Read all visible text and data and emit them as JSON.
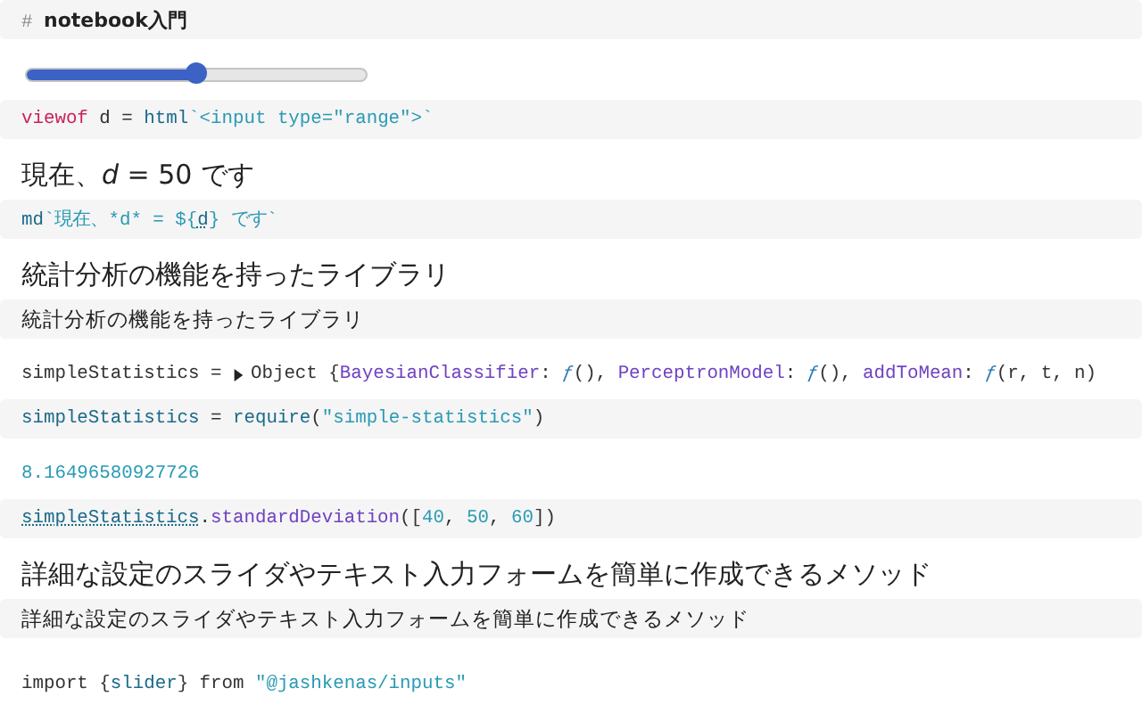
{
  "cells": [
    {
      "source": [
        {
          "kind": "comment",
          "text": "# "
        },
        {
          "kind": "bold",
          "text": "notebook入門"
        }
      ]
    },
    {
      "output": {
        "kind": "slider",
        "level": 0.5
      },
      "source": [
        {
          "kind": "keyword",
          "text": "viewof"
        },
        {
          "kind": "plain",
          "text": " d = "
        },
        {
          "kind": "variable",
          "text": "html"
        },
        {
          "kind": "string",
          "text": "`<input type=\"range\">`"
        }
      ]
    },
    {
      "output": {
        "kind": "text",
        "text": "現在、*d* = 50 です"
      },
      "source": [
        {
          "kind": "variable",
          "text": "md"
        },
        {
          "kind": "string",
          "text": "`現在、*d* = ${"
        },
        {
          "kind": "ref",
          "text": "d"
        },
        {
          "kind": "string",
          "text": "} です`"
        }
      ]
    },
    {
      "output": {
        "kind": "heading",
        "text": "統計分析の機能を持ったライブラリ"
      },
      "source": [
        {
          "kind": "prose",
          "text": "統計分析の機能を持ったライブラリ"
        }
      ]
    },
    {
      "output": {
        "kind": "object",
        "name": "simpleStatistics = ",
        "expanded": false,
        "tokens": [
          {
            "kind": "plain",
            "text": "Object {"
          },
          {
            "kind": "property",
            "text": "BayesianClassifier"
          },
          {
            "kind": "plain",
            "text": ": "
          },
          {
            "kind": "fn",
            "text": "ƒ"
          },
          {
            "kind": "plain",
            "text": "(), "
          },
          {
            "kind": "property",
            "text": "PerceptronModel"
          },
          {
            "kind": "plain",
            "text": ": "
          },
          {
            "kind": "fn",
            "text": "ƒ"
          },
          {
            "kind": "plain",
            "text": "(), "
          },
          {
            "kind": "property",
            "text": "addToMean"
          },
          {
            "kind": "plain",
            "text": ": "
          },
          {
            "kind": "fn",
            "text": "ƒ"
          },
          {
            "kind": "plain",
            "text": "(r, t, n)"
          }
        ]
      },
      "source": [
        {
          "kind": "variable",
          "text": "simpleStatistics"
        },
        {
          "kind": "plain",
          "text": " = "
        },
        {
          "kind": "variable",
          "text": "require"
        },
        {
          "kind": "plain",
          "text": "("
        },
        {
          "kind": "string",
          "text": "\"simple-statistics\""
        },
        {
          "kind": "plain",
          "text": ")"
        }
      ]
    },
    {
      "output": {
        "kind": "number",
        "text": "8.16496580927726"
      },
      "source": [
        {
          "kind": "ref",
          "text": "simpleStatistics"
        },
        {
          "kind": "plain",
          "text": "."
        },
        {
          "kind": "property",
          "text": "standardDeviation"
        },
        {
          "kind": "plain",
          "text": "(["
        },
        {
          "kind": "number",
          "text": "40"
        },
        {
          "kind": "plain",
          "text": ", "
        },
        {
          "kind": "number",
          "text": "50"
        },
        {
          "kind": "plain",
          "text": ", "
        },
        {
          "kind": "number",
          "text": "60"
        },
        {
          "kind": "plain",
          "text": "])"
        }
      ]
    },
    {
      "output": {
        "kind": "heading",
        "text": "詳細な設定のスライダやテキスト入力フォームを簡単に作成できるメソッド"
      },
      "source": [
        {
          "kind": "prose",
          "text": "詳細な設定のスライダやテキスト入力フォームを簡単に作成できるメソッド"
        }
      ]
    },
    {
      "output": {
        "kind": "import",
        "tokens": [
          {
            "kind": "plain",
            "text": "import {"
          },
          {
            "kind": "variable",
            "text": "slider"
          },
          {
            "kind": "plain",
            "text": "} from "
          },
          {
            "kind": "string",
            "text": "\"@jashkenas/inputs\""
          }
        ]
      }
    }
  ]
}
